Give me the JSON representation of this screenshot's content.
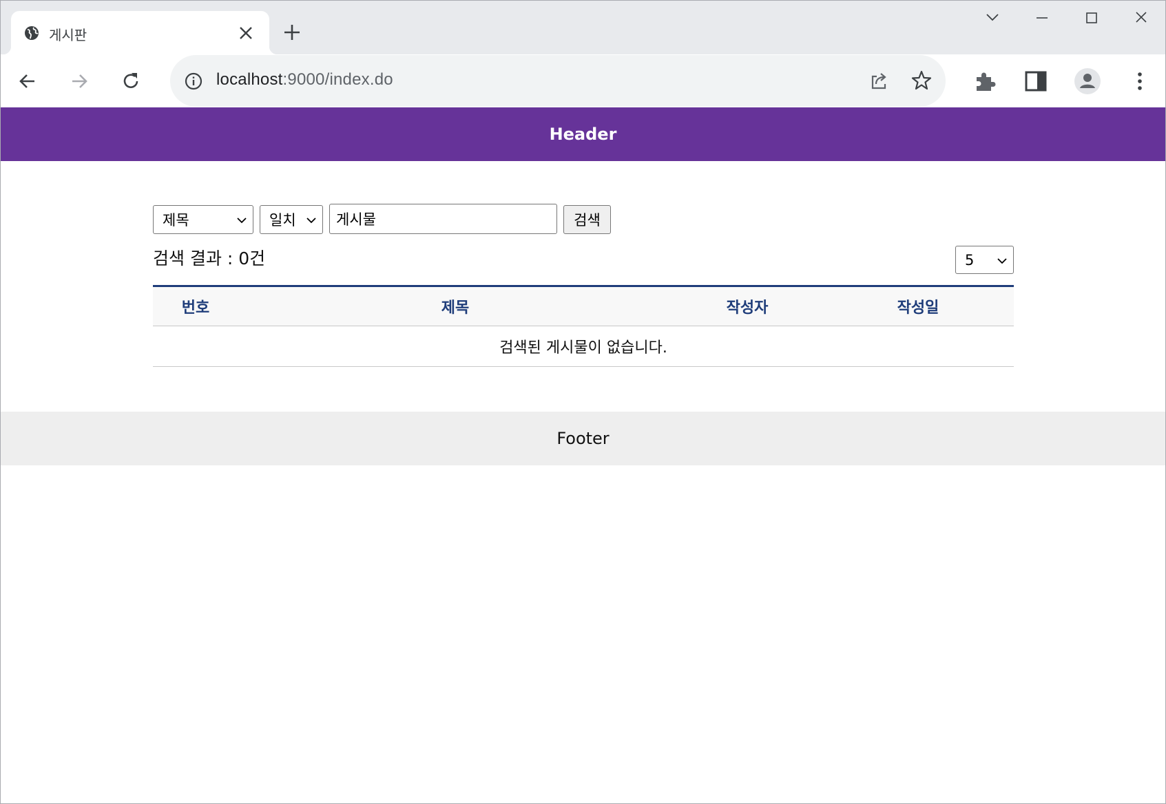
{
  "browser": {
    "tab": {
      "title": "게시판",
      "favicon": "globe-icon",
      "close_icon": "close-icon"
    },
    "new_tab_icon": "plus-icon",
    "window_controls": [
      "chevron-down-icon",
      "minimize-icon",
      "maximize-icon",
      "close-icon"
    ],
    "nav": {
      "back_icon": "back-arrow-icon",
      "forward_icon": "forward-arrow-icon",
      "reload_icon": "reload-icon"
    },
    "omnibox": {
      "host": "localhost",
      "rest": ":9000/index.do",
      "info_icon": "info-icon",
      "share_icon": "share-icon",
      "bookmark_icon": "star-icon"
    },
    "toolbar_icons": [
      "extensions-icon",
      "side-panel-icon",
      "profile-icon",
      "menu-icon"
    ]
  },
  "header": {
    "title": "Header"
  },
  "search": {
    "field_select": "제목",
    "match_select": "일치",
    "keyword": "게시물",
    "button_label": "검색"
  },
  "results": {
    "count_text": "검색 결과 : 0건",
    "page_size": "5"
  },
  "table": {
    "columns": [
      "번호",
      "제목",
      "작성자",
      "작성일"
    ],
    "empty_message": "검색된 게시물이 없습니다."
  },
  "footer": {
    "text": "Footer"
  },
  "colors": {
    "header_bg": "#663399",
    "table_accent": "#1f3d7a",
    "footer_bg": "#eeeeee"
  }
}
